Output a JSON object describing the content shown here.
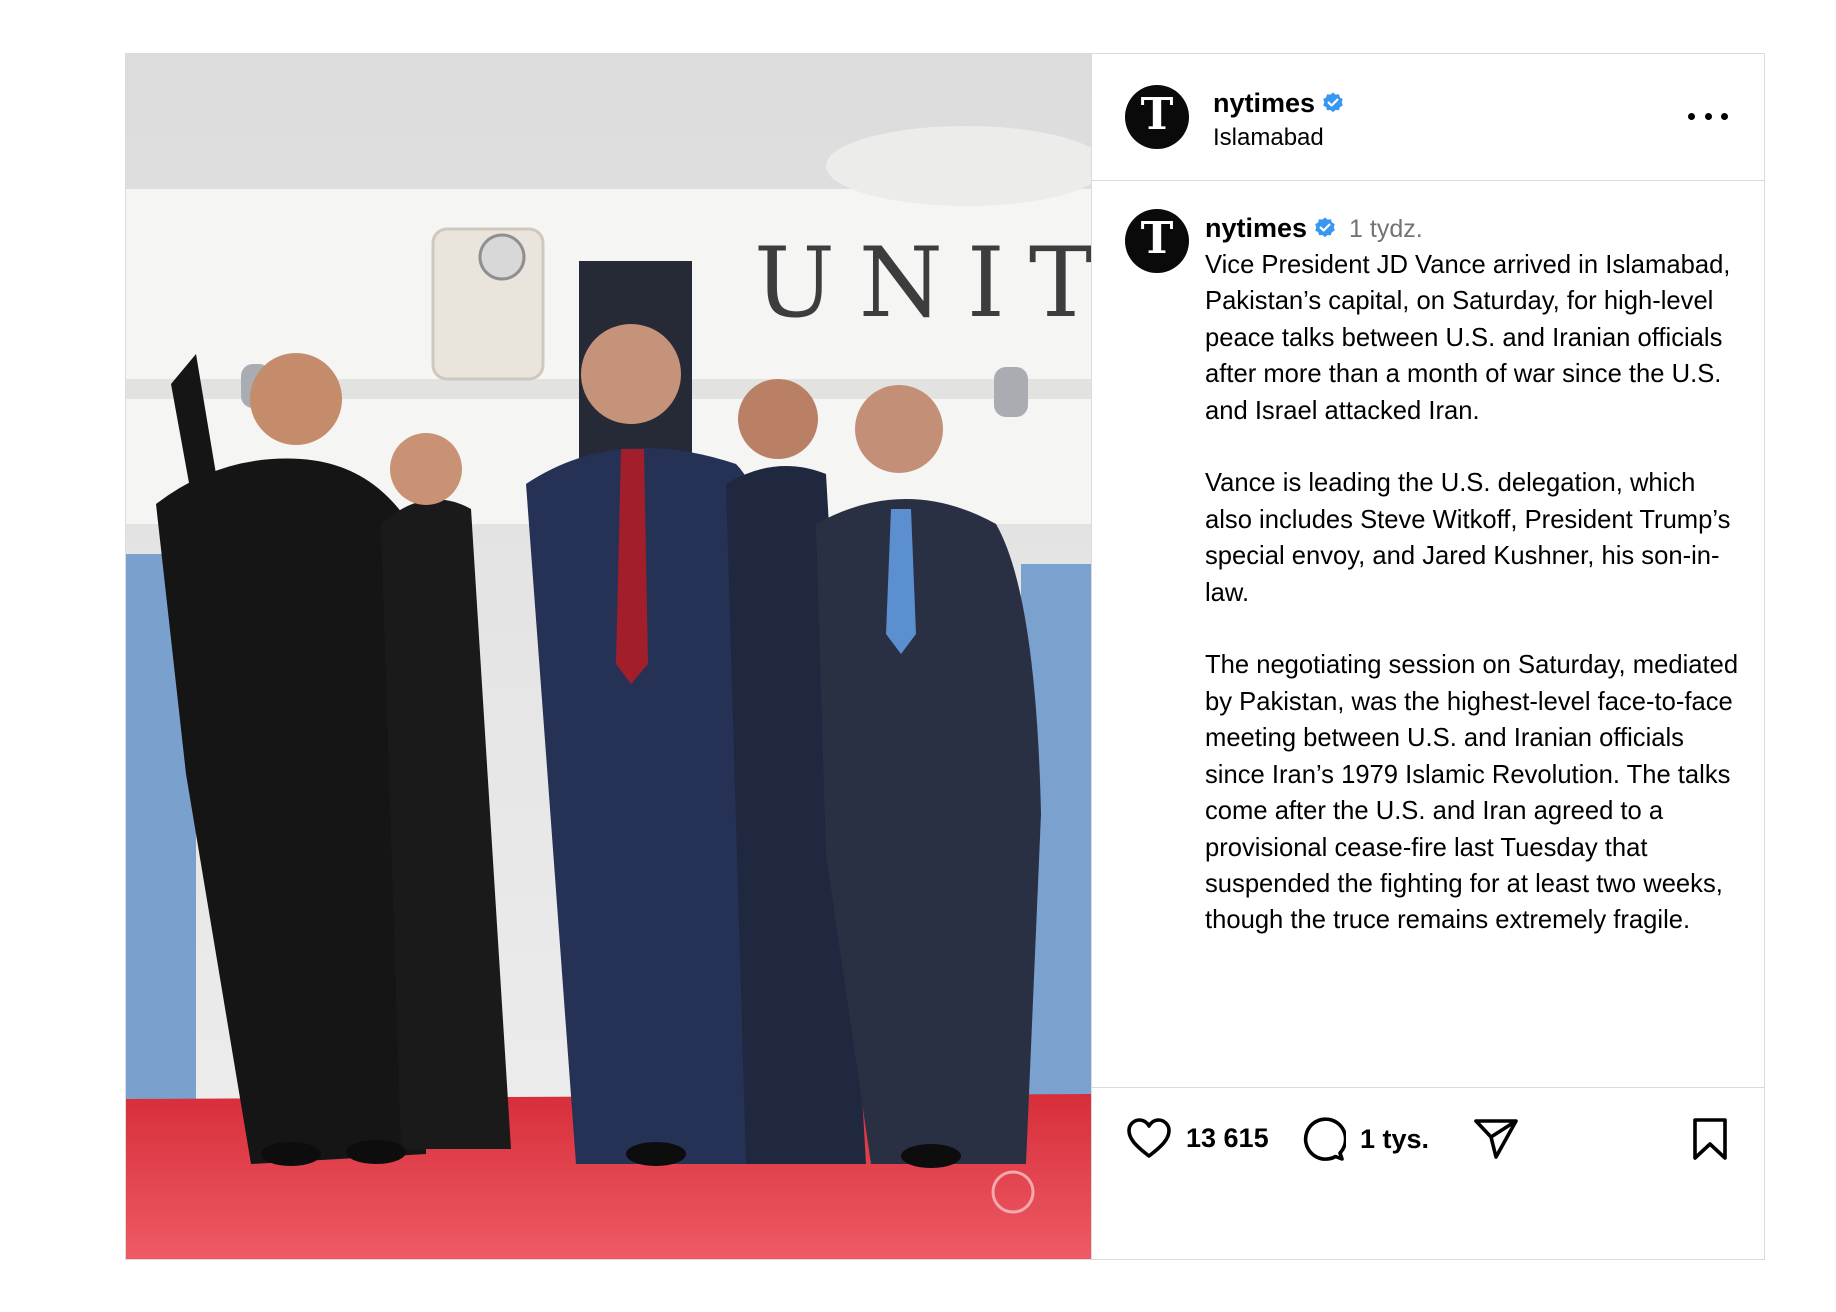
{
  "post": {
    "username": "nytimes",
    "verified": true,
    "location": "Islamabad",
    "avatar_letter": "T",
    "photo_description_icon": "photo",
    "photo_aircraft_lettering": "UNIT",
    "more_icon": "more-horizontal-icon"
  },
  "caption": {
    "username": "nytimes",
    "time": "1 tydz.",
    "text": "Vice President JD Vance arrived in Islamabad, Pakistan’s capital, on Saturday, for high-level peace talks between U.S. and Iranian officials after more than a month of war since the U.S. and Israel attacked Iran.\n\nVance is leading the U.S. delegation, which also includes Steve Witkoff, President Trump’s special envoy, and Jared Kushner, his son-in-law.\n\nThe negotiating session on Saturday, mediated by Pakistan, was the highest-level face-to-face meeting between U.S. and Iranian officials since Iran’s 1979 Islamic Revolution. The talks come after the U.S. and Iran agreed to a provisional cease-fire last Tuesday that suspended the fighting for at least two weeks, though the truce remains extremely fragile."
  },
  "actions": {
    "likes": "13 615",
    "comments": "1 tys.",
    "like_icon": "heart-icon",
    "comment_icon": "comment-icon",
    "share_icon": "send-icon",
    "save_icon": "bookmark-icon"
  },
  "colors": {
    "verified_blue": "#3897f0",
    "border": "#dbdbdb",
    "muted": "#737373",
    "carpet_red": "#e0303c"
  }
}
